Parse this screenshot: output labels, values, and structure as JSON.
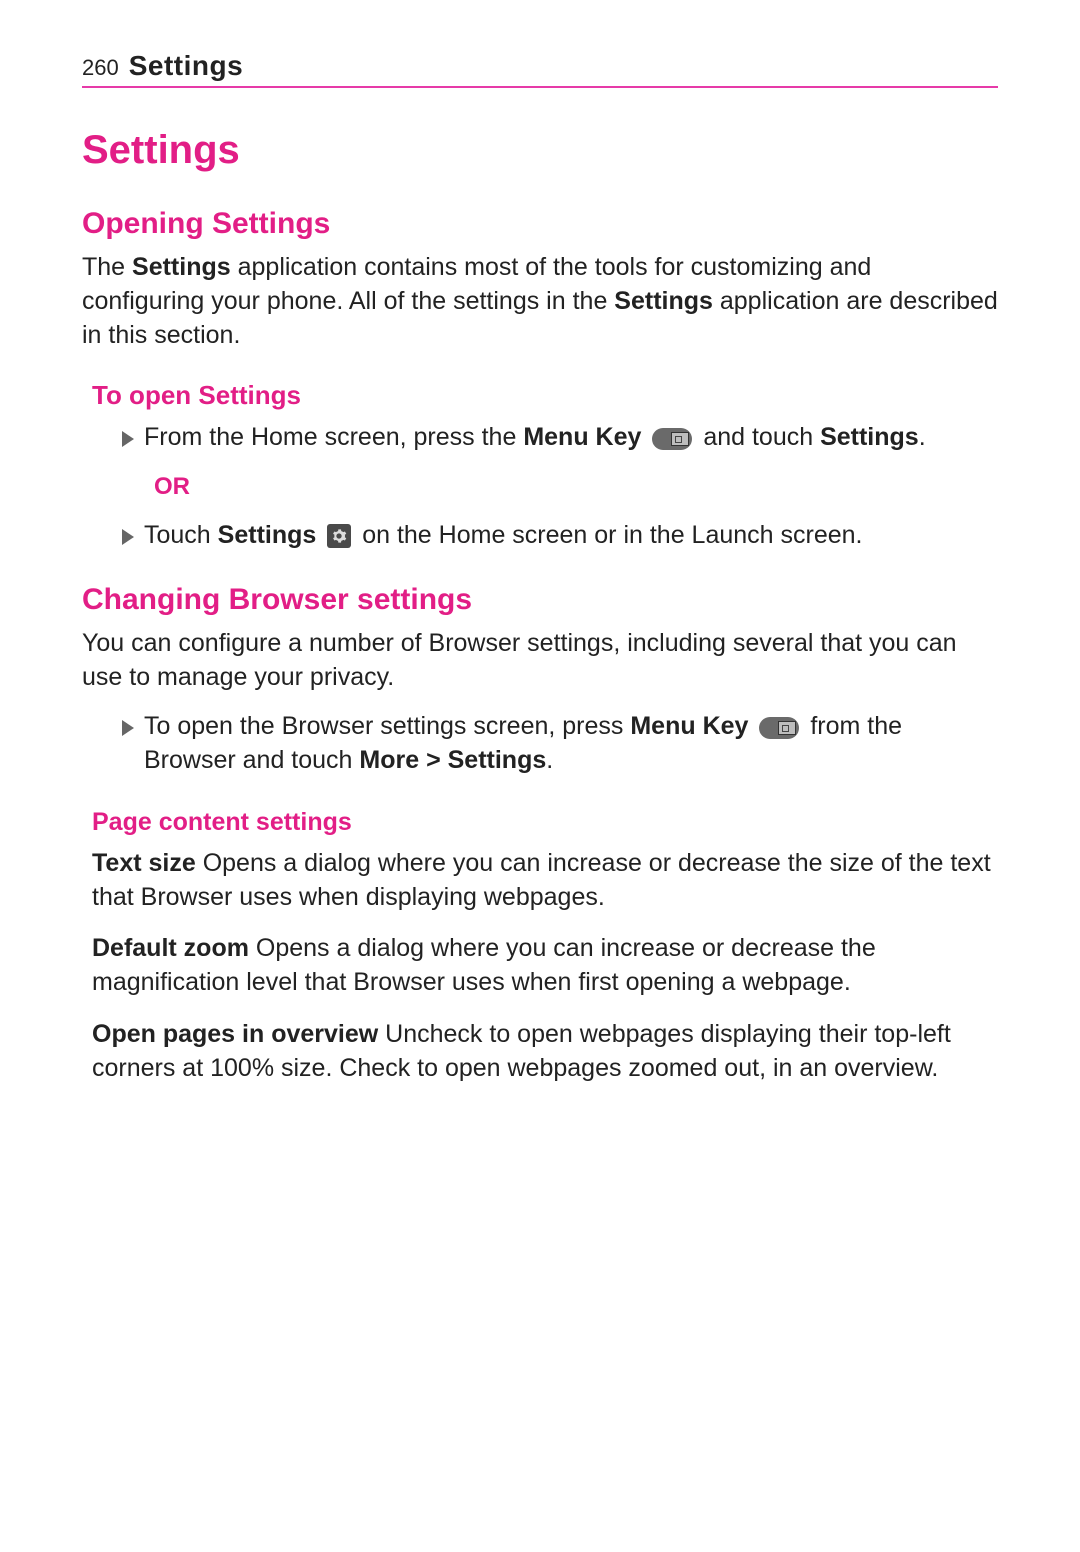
{
  "header": {
    "page_number": "260",
    "title": "Settings"
  },
  "title": "Settings",
  "section_opening": {
    "heading": "Opening Settings",
    "intro_1": "The ",
    "intro_bold_1": "Settings",
    "intro_2": " application contains most of the tools for customizing and configuring your phone. All of the settings in the ",
    "intro_bold_2": "Settings",
    "intro_3": " application are described in this section.",
    "sub_heading": "To open Settings",
    "bullet1_a": "From the Home screen, press the ",
    "bullet1_bold": "Menu Key",
    "bullet1_b": " and touch ",
    "bullet1_bold2": "Settings",
    "bullet1_c": ".",
    "or": "OR",
    "bullet2_a": "Touch ",
    "bullet2_bold": "Settings",
    "bullet2_b": " on the Home screen or in the Launch screen."
  },
  "section_browser": {
    "heading": "Changing Browser settings",
    "intro": "You can configure a number of Browser settings, including several that you can use to manage your privacy.",
    "bullet1_a": "To open the Browser settings screen, press ",
    "bullet1_bold": "Menu Key",
    "bullet1_b": " from the Browser and touch ",
    "bullet1_bold2": "More > Settings",
    "bullet1_c": ".",
    "sub_heading": "Page content settings",
    "items": [
      {
        "name": "Text size",
        "desc": " Opens a dialog where you can increase or decrease the size of the text that Browser uses when displaying webpages."
      },
      {
        "name": "Default zoom",
        "desc": " Opens a dialog where you can increase or decrease the magnification level that Browser uses when first opening a webpage."
      },
      {
        "name": "Open pages in overview",
        "desc": " Uncheck to open webpages displaying their top-left corners at 100% size. Check to open webpages zoomed out, in an overview."
      }
    ]
  }
}
